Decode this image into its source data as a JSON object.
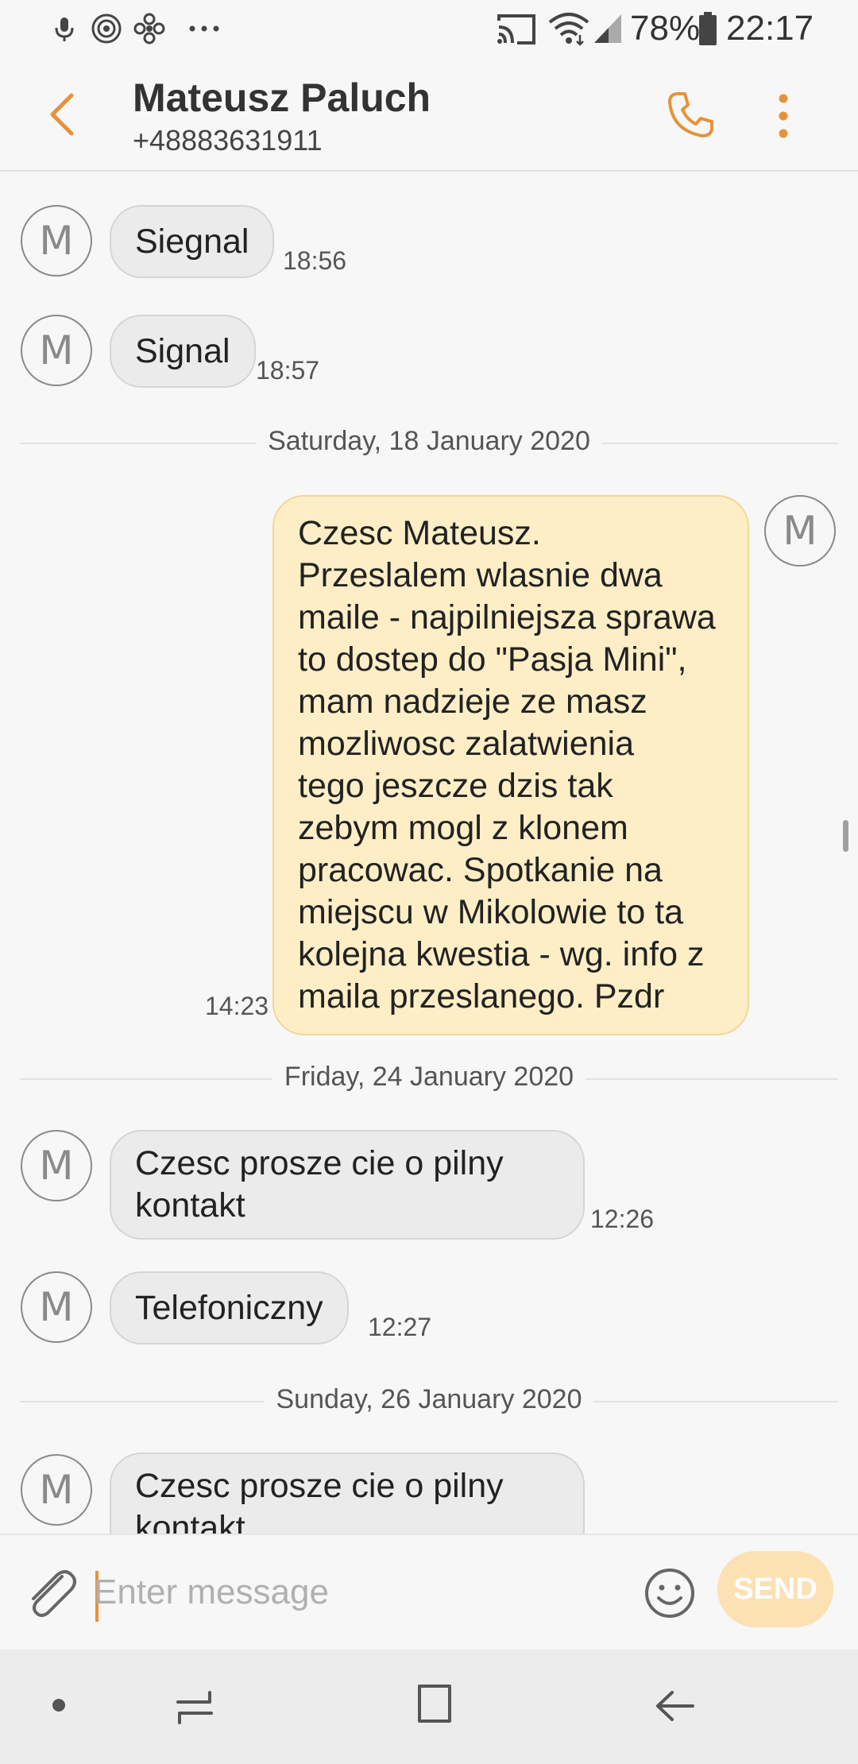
{
  "status_bar": {
    "battery": "78%",
    "time": "22:17",
    "icons": [
      "mic-icon",
      "radio-icon",
      "fan-icon",
      "more-dots-icon",
      "cast-icon",
      "wifi-icon",
      "signal-icon",
      "battery-icon"
    ]
  },
  "header": {
    "contact_name": "Mateusz Paluch",
    "contact_number": "+48883631911"
  },
  "conversation": {
    "avatar_letter": "M",
    "items": [
      {
        "type": "in",
        "text": "Siegnal",
        "time": "18:56"
      },
      {
        "type": "in",
        "text": "Signal",
        "time": "18:57"
      },
      {
        "type": "date",
        "text": "Saturday, 18 January 2020"
      },
      {
        "type": "out",
        "lines": [
          "Czesc Mateusz.",
          "Przeslalem wlasnie dwa",
          "maile - najpilniejsza sprawa",
          "to dostep do \"Pasja Mini\",",
          "mam nadzieje ze masz",
          "mozliwosc zalatwienia",
          "tego jeszcze dzis tak",
          "zebym mogl z klonem",
          "pracowac. Spotkanie na",
          "miejscu w Mikolowie to ta",
          "kolejna kwestia - wg. info z",
          "maila przeslanego. Pzdr"
        ],
        "time": "14:23"
      },
      {
        "type": "date",
        "text": "Friday, 24 January 2020"
      },
      {
        "type": "in",
        "lines": [
          "Czesc prosze cie o pilny",
          "kontakt"
        ],
        "time": "12:26"
      },
      {
        "type": "in",
        "text": "Telefoniczny",
        "time": "12:27"
      },
      {
        "type": "date",
        "text": "Sunday, 26 January 2020"
      },
      {
        "type": "in",
        "lines": [
          "Czesc prosze cie o pilny",
          "kontakt"
        ]
      }
    ]
  },
  "composer": {
    "placeholder": "Enter message",
    "send_label": "SEND"
  },
  "colors": {
    "accent": "#e8913a",
    "incoming_bubble": "#ebebeb",
    "outgoing_bubble": "#fdeec6",
    "send_button": "#fce1b3"
  }
}
